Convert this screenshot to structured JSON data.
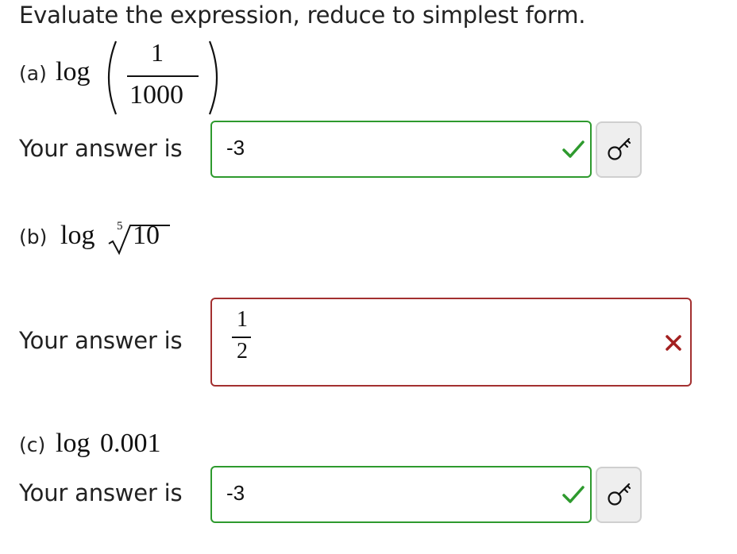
{
  "prompt": "Evaluate the expression, reduce to simplest form.",
  "parts": [
    {
      "label": "(a)",
      "expr": {
        "func": "log",
        "numerator": "1",
        "denominator": "1000"
      },
      "answer_label": "Your answer is",
      "answer_value": "-3",
      "status": "correct",
      "status_icon": "checkmark-icon",
      "has_key_button": true
    },
    {
      "label": "(b)",
      "expr": {
        "func": "log",
        "root_index": "5",
        "radicand": "10"
      },
      "answer_label": "Your answer is",
      "answer_numerator": "1",
      "answer_denominator": "2",
      "status": "incorrect",
      "status_icon": "x-mark-icon",
      "has_key_button": false
    },
    {
      "label": "(c)",
      "expr": {
        "func": "log",
        "argument": "0.001"
      },
      "answer_label": "Your answer is",
      "answer_value": "-3",
      "status": "correct",
      "status_icon": "checkmark-icon",
      "has_key_button": true
    }
  ],
  "colors": {
    "correct": "#2e9a2e",
    "incorrect": "#a33030",
    "button_bg": "#eeeeee"
  }
}
